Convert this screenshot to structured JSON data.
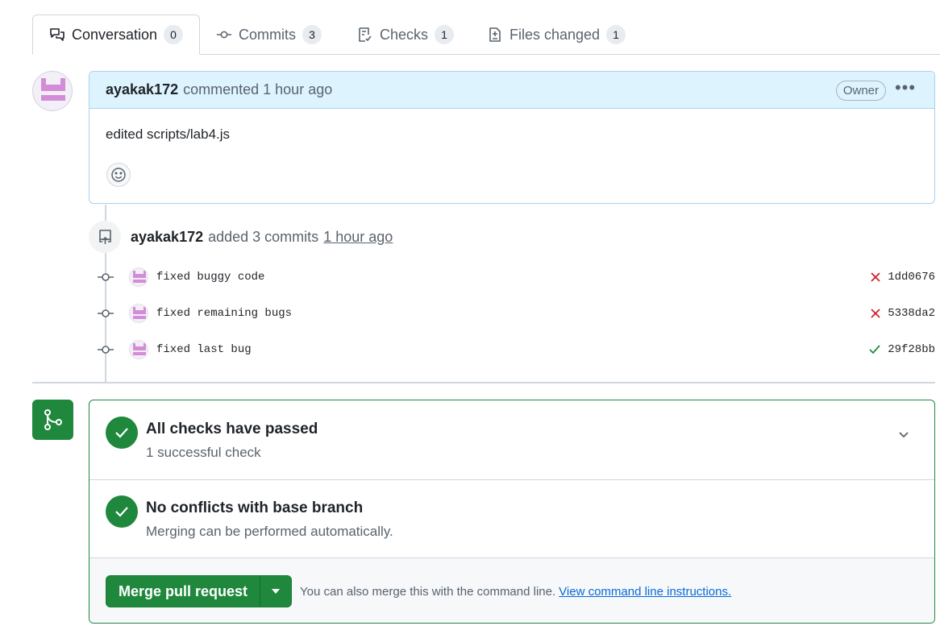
{
  "tabs": [
    {
      "label": "Conversation",
      "count": "0",
      "icon": "comment-discussion-icon"
    },
    {
      "label": "Commits",
      "count": "3",
      "icon": "git-commit-icon"
    },
    {
      "label": "Checks",
      "count": "1",
      "icon": "checklist-icon"
    },
    {
      "label": "Files changed",
      "count": "1",
      "icon": "file-diff-icon"
    }
  ],
  "comment": {
    "author": "ayakak172",
    "meta": "commented 1 hour ago",
    "badge": "Owner",
    "body": "edited scripts/lab4.js"
  },
  "commits_summary": {
    "author": "ayakak172",
    "meta": "added 3 commits",
    "time": "1 hour ago"
  },
  "commits": [
    {
      "message": "fixed buggy code",
      "sha": "1dd0676",
      "status": "failed"
    },
    {
      "message": "fixed remaining bugs",
      "sha": "5338da2",
      "status": "failed"
    },
    {
      "message": "fixed last bug",
      "sha": "29f28bb",
      "status": "passed"
    }
  ],
  "merge": {
    "checks_title": "All checks have passed",
    "checks_sub": "1 successful check",
    "conflicts_title": "No conflicts with base branch",
    "conflicts_sub": "Merging can be performed automatically.",
    "button_label": "Merge pull request",
    "hint": "You can also merge this with the command line.",
    "hint_link": "View command line instructions."
  },
  "colors": {
    "success": "#1f883d",
    "danger": "#cf222e",
    "link": "#0969da",
    "comment_header": "#ddf4ff"
  }
}
